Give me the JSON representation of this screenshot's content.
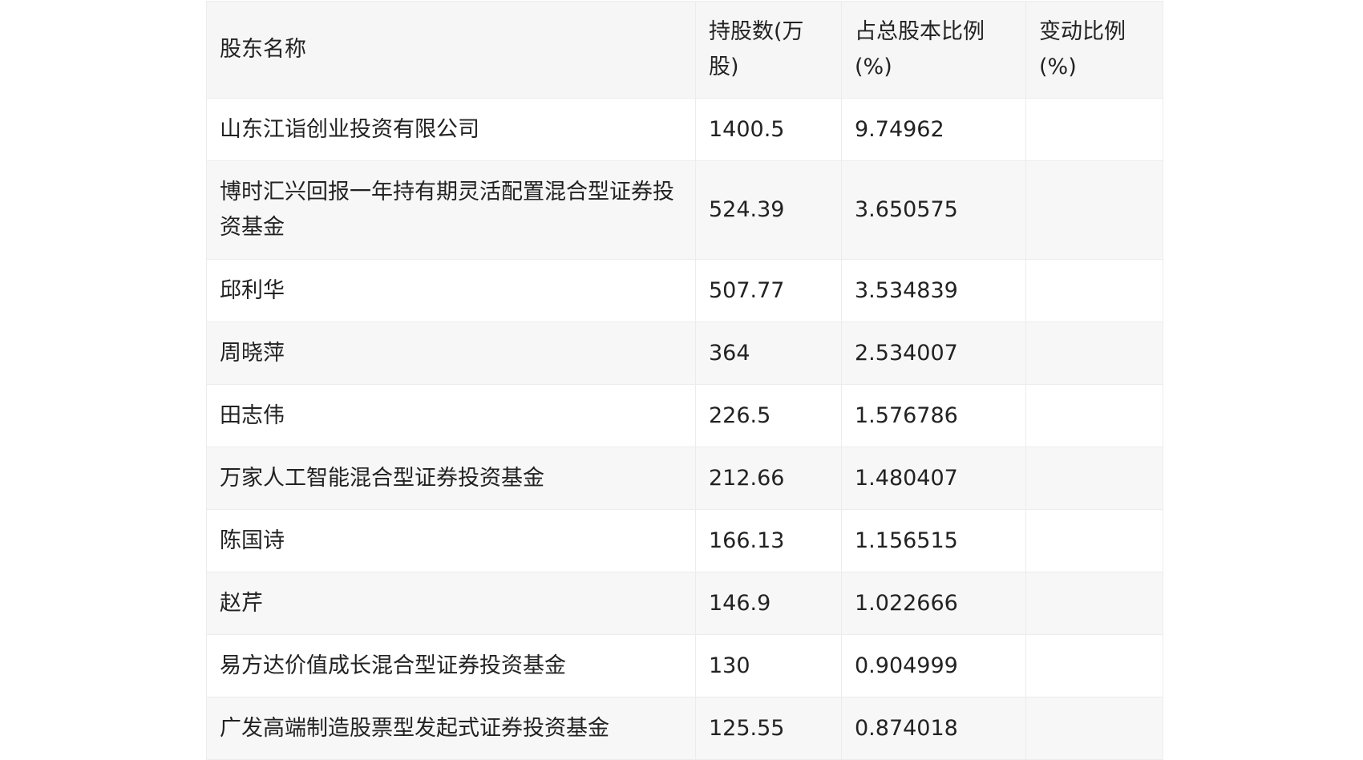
{
  "table": {
    "headers": {
      "name": "股东名称",
      "shares": "持股数(万股)",
      "ratio": "占总股本比例(%)",
      "change": "变动比例(%)"
    },
    "rows": [
      {
        "name": "山东江诣创业投资有限公司",
        "shares": "1400.5",
        "ratio": "9.74962",
        "change": ""
      },
      {
        "name": "博时汇兴回报一年持有期灵活配置混合型证券投资基金",
        "shares": "524.39",
        "ratio": "3.650575",
        "change": ""
      },
      {
        "name": "邱利华",
        "shares": "507.77",
        "ratio": "3.534839",
        "change": ""
      },
      {
        "name": "周晓萍",
        "shares": "364",
        "ratio": "2.534007",
        "change": ""
      },
      {
        "name": "田志伟",
        "shares": "226.5",
        "ratio": "1.576786",
        "change": ""
      },
      {
        "name": "万家人工智能混合型证券投资基金",
        "shares": "212.66",
        "ratio": "1.480407",
        "change": ""
      },
      {
        "name": "陈国诗",
        "shares": "166.13",
        "ratio": "1.156515",
        "change": ""
      },
      {
        "name": "赵芹",
        "shares": "146.9",
        "ratio": "1.022666",
        "change": ""
      },
      {
        "name": "易方达价值成长混合型证券投资基金",
        "shares": "130",
        "ratio": "0.904999",
        "change": ""
      },
      {
        "name": "广发高端制造股票型发起式证券投资基金",
        "shares": "125.55",
        "ratio": "0.874018",
        "change": ""
      }
    ]
  }
}
